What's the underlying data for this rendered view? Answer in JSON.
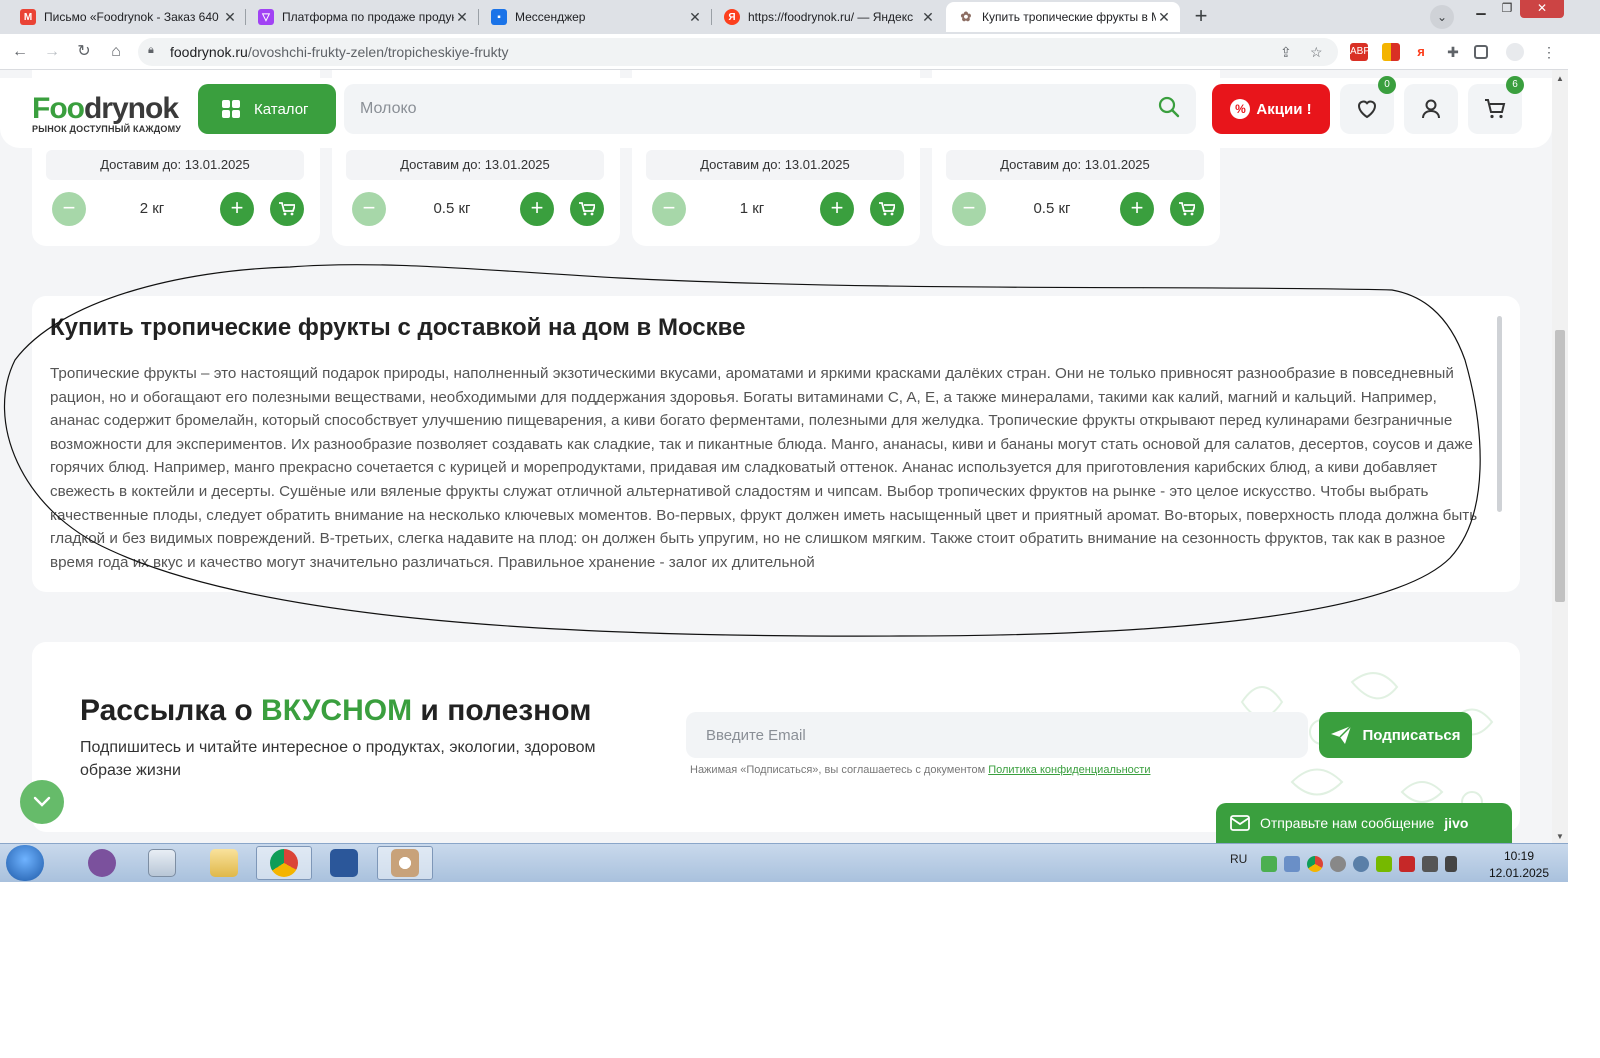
{
  "browser": {
    "tabs": [
      {
        "title": "Письмо «Foodrynok - Заказ 640",
        "icon": "gmail-icon",
        "color": "#ea4335"
      },
      {
        "title": "Платформа по продаже продук",
        "icon": "platform-icon",
        "color": "#a142f4"
      },
      {
        "title": "Мессенджер",
        "icon": "messenger-icon",
        "color": "#1a73e8"
      },
      {
        "title": "https://foodrynok.ru/ — Яндекс",
        "icon": "yandex-icon",
        "color": "#fc3f1d"
      },
      {
        "title": "Купить тропические фрукты в М",
        "icon": "site-icon",
        "color": "#8d6e63"
      }
    ],
    "url_host": "foodrynok.ru",
    "url_path": "/ovoshchi-frukty-zelen/tropicheskiye-frukty"
  },
  "header": {
    "logo_food": "F",
    "logo_oo": "oo",
    "logo_rest": "drynok",
    "logo_tagline": "РЫНОК ДОСТУПНЫЙ КАЖДОМУ",
    "catalog_label": "Каталог",
    "search_placeholder": "Молоко",
    "promo_label": "Акции !",
    "promo_icon": "%",
    "favorites_count": "0",
    "cart_count": "6"
  },
  "products": [
    {
      "delivery": "Доставим до: 13.01.2025",
      "qty": "2 кг"
    },
    {
      "delivery": "Доставим до: 13.01.2025",
      "qty": "0.5 кг"
    },
    {
      "delivery": "Доставим до: 13.01.2025",
      "qty": "1 кг"
    },
    {
      "delivery": "Доставим до: 13.01.2025",
      "qty": "0.5 кг"
    }
  ],
  "seo": {
    "title": "Купить тропические фрукты с доставкой на дом в Москве",
    "text": "Тропические фрукты – это настоящий подарок природы, наполненный экзотическими вкусами, ароматами и яркими красками далёких стран. Они не только привносят разнообразие в повседневный рацион, но и обогащают его полезными веществами, необходимыми для поддержания здоровья. Богаты витаминами C, A, E, а также минералами, такими как калий, магний и кальций. Например, ананас содержит бромелайн, который способствует улучшению пищеварения, а киви богато ферментами, полезными для желудка. Тропические фрукты открывают перед кулинарами безграничные возможности для экспериментов. Их разнообразие позволяет создавать как сладкие, так и пикантные блюда. Манго, ананасы, киви и бананы могут стать основой для салатов, десертов, соусов и даже горячих блюд. Например, манго прекрасно сочетается с курицей и морепродуктами, придавая им сладковатый оттенок. Ананас используется для приготовления карибских блюд, а киви добавляет свежесть в коктейли и десерты. Сушёные или вяленые фрукты служат отличной альтернативой сладостям и чипсам. Выбор тропических фруктов на рынке - это целое искусство. Чтобы выбрать качественные плоды, следует обратить внимание на несколько ключевых моментов. Во-первых, фрукт должен иметь насыщенный цвет и приятный аромат. Во-вторых, поверхность плода должна быть гладкой и без видимых повреждений. В-третьих, слегка надавите на плод: он должен быть упругим, но не слишком мягким. Также стоит обратить внимание на сезонность фруктов, так как в разное время года их вкус и качество могут значительно различаться. Правильное хранение - залог их длительной"
  },
  "newsletter": {
    "title_a": "Рассылка о ",
    "title_b": "ВКУСНОМ",
    "title_c": " и полезном",
    "subtitle": "Подпишитесь и читайте интересное о продуктах, экологии, здоровом образе жизни",
    "email_placeholder": "Введите Email",
    "subscribe_label": "Подписаться",
    "agree_text": "Нажимая «Подписаться», вы соглашаетесь с документом ",
    "policy_link": "Политика конфиденциальности"
  },
  "chat": {
    "label": "Отправьте нам сообщение",
    "brand": "jivo"
  },
  "taskbar": {
    "lang": "RU",
    "time": "10:19",
    "date": "12.01.2025"
  },
  "colors": {
    "brand_green": "#3a9f3e",
    "promo_red": "#e8151b"
  }
}
